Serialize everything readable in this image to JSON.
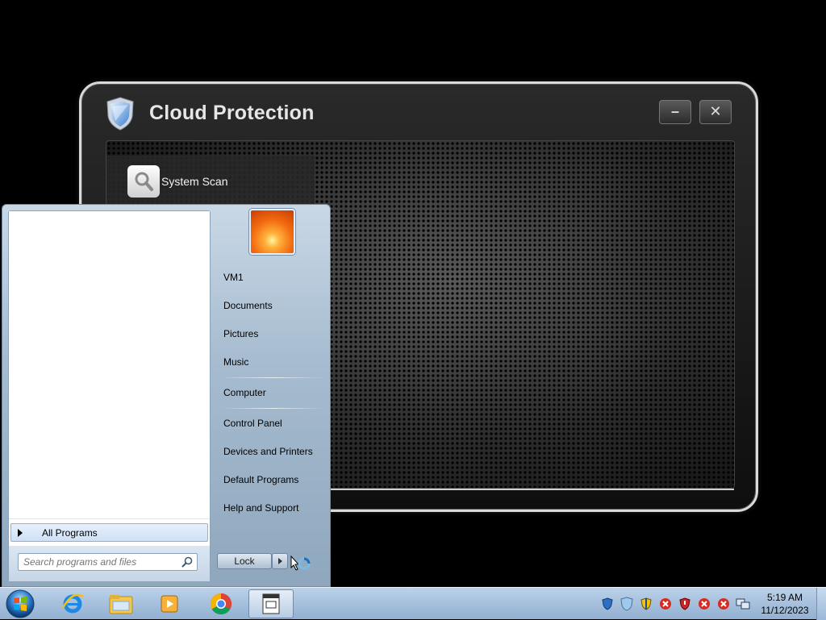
{
  "cloud_protection": {
    "title": "Cloud Protection",
    "minimize_label": "–",
    "close_label": "✕",
    "nav": [
      {
        "label": "System Scan",
        "icon": "magnifier-icon"
      },
      {
        "label": "",
        "icon": "app-icon"
      }
    ]
  },
  "start_menu": {
    "right_links": {
      "user": "VM1",
      "documents": "Documents",
      "pictures": "Pictures",
      "music": "Music",
      "computer": "Computer",
      "control_panel": "Control Panel",
      "devices_printers": "Devices and Printers",
      "default_programs": "Default Programs",
      "help_support": "Help and Support"
    },
    "all_programs": "All Programs",
    "search_placeholder": "Search programs and files",
    "lock_label": "Lock"
  },
  "taskbar": {
    "pinned": [
      "internet-explorer-icon",
      "file-explorer-icon",
      "media-player-icon",
      "chrome-icon",
      "cloud-protection-app-icon"
    ],
    "tray_icons": [
      "security-shield-icon",
      "cloud-protection-tray-icon",
      "action-center-flag-icon",
      "error-icon",
      "antivirus-alert-icon",
      "error-icon",
      "error-icon",
      "network-icon"
    ],
    "clock": {
      "time": "5:19 AM",
      "date": "11/12/2023"
    }
  }
}
